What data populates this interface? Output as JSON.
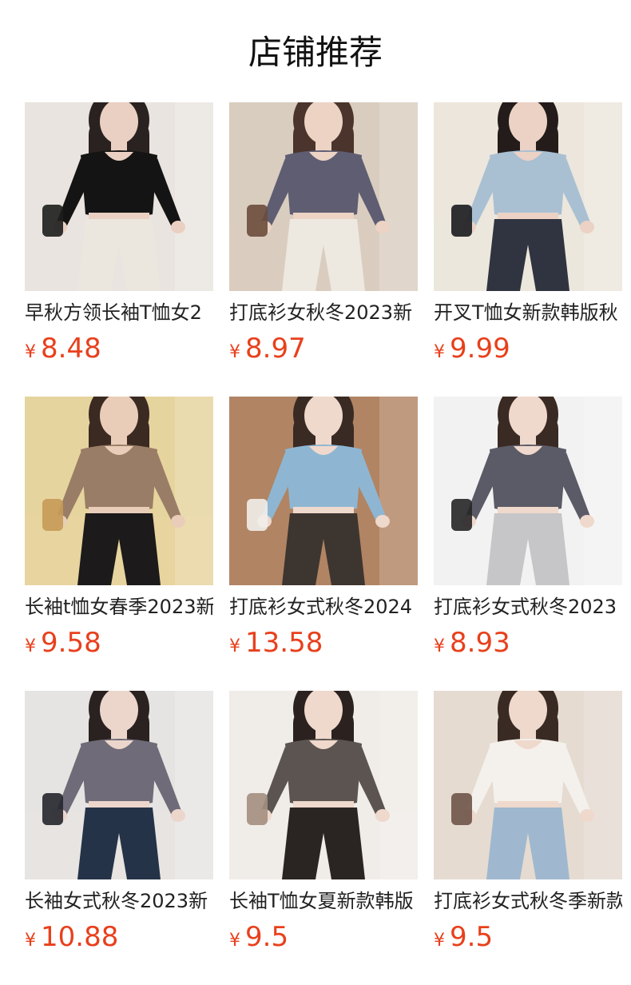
{
  "section": {
    "title": "店铺推荐"
  },
  "currency_symbol": "¥",
  "products": [
    {
      "name": "早秋方领长袖T恤女2",
      "price": "8.48",
      "colors": {
        "bg": "#e9e4df",
        "top": "#141414",
        "bottom": "#ebe6de",
        "skin": "#ead0c2",
        "hair": "#2a2220",
        "accent": "#1d1d1d"
      }
    },
    {
      "name": "打底衫女秋冬2023新",
      "price": "8.97",
      "colors": {
        "bg": "#d9cdbf",
        "top": "#5f5d72",
        "bottom": "#ede9e1",
        "skin": "#ecd3c4",
        "hair": "#4a342c",
        "accent": "#6c4c3c"
      }
    },
    {
      "name": "开叉T恤女新款韩版秋",
      "price": "9.99",
      "colors": {
        "bg": "#ece6dc",
        "top": "#a9c0d3",
        "bottom": "#2f3440",
        "skin": "#ebd2c5",
        "hair": "#231c1a",
        "accent": "#1b1b1f"
      }
    },
    {
      "name": "长袖t恤女春季2023新",
      "price": "9.58",
      "colors": {
        "bg": "#e6d49e",
        "top": "#9a7d66",
        "bottom": "#1c1a1a",
        "skin": "#e9cdb8",
        "hair": "#3b2a22",
        "accent": "#c79a56"
      }
    },
    {
      "name": "打底衫女式秋冬2024",
      "price": "13.58",
      "colors": {
        "bg": "#b18463",
        "top": "#8eb6d3",
        "bottom": "#3d3530",
        "skin": "#efd8cc",
        "hair": "#3a2a24",
        "accent": "#f1eeea"
      }
    },
    {
      "name": "打底衫女式秋冬2023",
      "price": "8.93",
      "colors": {
        "bg": "#f2f2f2",
        "top": "#5a5b66",
        "bottom": "#c6c6c8",
        "skin": "#efd8cc",
        "hair": "#3a2a24",
        "accent": "#262626"
      }
    },
    {
      "name": "长袖女式秋冬2023新",
      "price": "10.88",
      "colors": {
        "bg": "#e6e4e2",
        "top": "#6f6b78",
        "bottom": "#253348",
        "skin": "#ecd6cc",
        "hair": "#2a2220",
        "accent": "#23262d"
      }
    },
    {
      "name": "长袖T恤女夏新款韩版",
      "price": "9.5",
      "colors": {
        "bg": "#f0ece7",
        "top": "#5b5450",
        "bottom": "#2a2423",
        "skin": "#efd8cc",
        "hair": "#2b221f",
        "accent": "#a38f80"
      }
    },
    {
      "name": "打底衫女式秋冬季新款",
      "price": "9.5",
      "colors": {
        "bg": "#e5dbd1",
        "top": "#f4f1ec",
        "bottom": "#9fb8cf",
        "skin": "#efd8cc",
        "hair": "#3a2a24",
        "accent": "#6e5448"
      }
    }
  ]
}
